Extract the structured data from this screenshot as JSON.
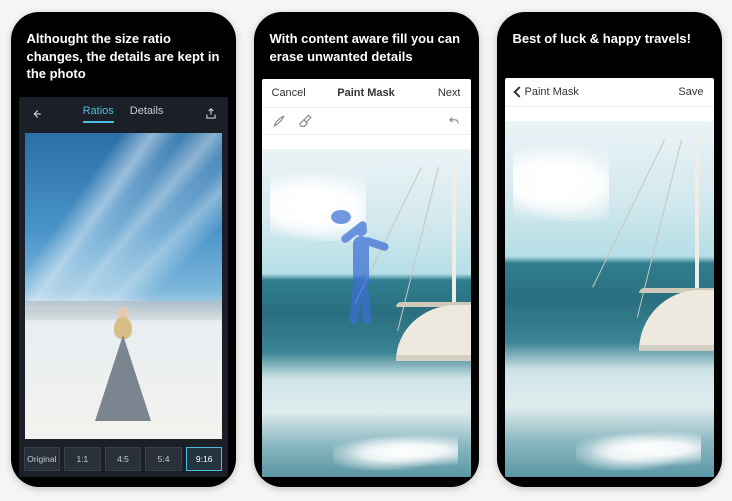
{
  "screens": [
    {
      "caption": "Althought the size ratio changes, the details are kept in the photo",
      "tabs": {
        "ratios": "Ratios",
        "details": "Details"
      },
      "ratio_buttons": [
        "Original",
        "1:1",
        "4:5",
        "5:4",
        "9:16"
      ],
      "active_ratio_index": 4
    },
    {
      "caption": "With content aware fill you can erase unwanted details",
      "nav": {
        "cancel": "Cancel",
        "title": "Paint Mask",
        "next": "Next"
      }
    },
    {
      "caption": "Best of luck & happy travels!",
      "nav": {
        "back": "Paint Mask",
        "save": "Save"
      }
    }
  ]
}
